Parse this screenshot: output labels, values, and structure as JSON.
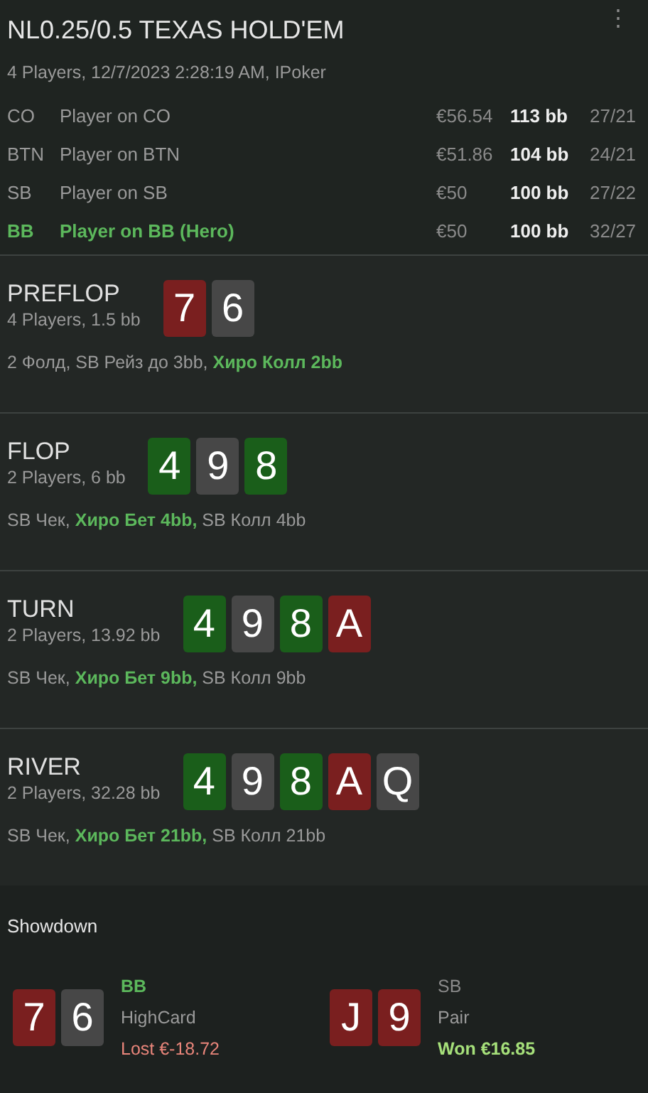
{
  "header": {
    "title": "NL0.25/0.5 TEXAS HOLD'EM",
    "menu_icon": "⋮",
    "subtitle": "4 Players, 12/7/2023 2:28:19 AM, IPoker"
  },
  "players": [
    {
      "position": "CO",
      "name": "Player on CO",
      "stack": "€56.54",
      "bb": "113 bb",
      "stats": "27/21",
      "hero": false
    },
    {
      "position": "BTN",
      "name": "Player on BTN",
      "stack": "€51.86",
      "bb": "104 bb",
      "stats": "24/21",
      "hero": false
    },
    {
      "position": "SB",
      "name": "Player on SB",
      "stack": "€50",
      "bb": "100 bb",
      "stats": "27/22",
      "hero": false
    },
    {
      "position": "BB",
      "name": "Player on BB (Hero)",
      "stack": "€50",
      "bb": "100 bb",
      "stats": "32/27",
      "hero": true
    }
  ],
  "streets": [
    {
      "name": "PREFLOP",
      "info": "4 Players, 1.5 bb",
      "cards": [
        {
          "rank": "7",
          "color": "#7a1f1f"
        },
        {
          "rank": "6",
          "color": "#474747"
        }
      ],
      "actions": [
        {
          "text": "2 Фолд, SB Рейз до 3bb, ",
          "hero": false
        },
        {
          "text": "Хиро Колл 2bb",
          "hero": true
        }
      ]
    },
    {
      "name": "FLOP",
      "info": "2 Players, 6 bb",
      "cards": [
        {
          "rank": "4",
          "color": "#1a5e1a"
        },
        {
          "rank": "9",
          "color": "#474747"
        },
        {
          "rank": "8",
          "color": "#1a5e1a"
        }
      ],
      "actions": [
        {
          "text": "SB Чек, ",
          "hero": false
        },
        {
          "text": "Хиро Бет 4bb,",
          "hero": true
        },
        {
          "text": " SB Колл 4bb",
          "hero": false
        }
      ]
    },
    {
      "name": "TURN",
      "info": "2 Players, 13.92 bb",
      "cards": [
        {
          "rank": "4",
          "color": "#1a5e1a"
        },
        {
          "rank": "9",
          "color": "#474747"
        },
        {
          "rank": "8",
          "color": "#1a5e1a"
        },
        {
          "rank": "A",
          "color": "#7a1f1f"
        }
      ],
      "actions": [
        {
          "text": "SB Чек, ",
          "hero": false
        },
        {
          "text": "Хиро Бет 9bb,",
          "hero": true
        },
        {
          "text": " SB Колл 9bb",
          "hero": false
        }
      ]
    },
    {
      "name": "RIVER",
      "info": "2 Players, 32.28 bb",
      "cards": [
        {
          "rank": "4",
          "color": "#1a5e1a"
        },
        {
          "rank": "9",
          "color": "#474747"
        },
        {
          "rank": "8",
          "color": "#1a5e1a"
        },
        {
          "rank": "A",
          "color": "#7a1f1f"
        },
        {
          "rank": "Q",
          "color": "#474747"
        }
      ],
      "actions": [
        {
          "text": "SB Чек, ",
          "hero": false
        },
        {
          "text": "Хиро Бет 21bb,",
          "hero": true
        },
        {
          "text": " SB Колл 21bb",
          "hero": false
        }
      ]
    }
  ],
  "showdown": {
    "title": "Showdown",
    "hands": [
      {
        "cards": [
          {
            "rank": "7",
            "color": "#7a1f1f"
          },
          {
            "rank": "6",
            "color": "#474747"
          }
        ],
        "position": "BB",
        "hero": true,
        "hand": "HighCard",
        "result": "Lost €-18.72",
        "won": false
      },
      {
        "cards": [
          {
            "rank": "J",
            "color": "#7a1f1f"
          },
          {
            "rank": "9",
            "color": "#7a1f1f"
          }
        ],
        "position": "SB",
        "hero": false,
        "hand": "Pair",
        "result": "Won €16.85",
        "won": true
      }
    ]
  }
}
